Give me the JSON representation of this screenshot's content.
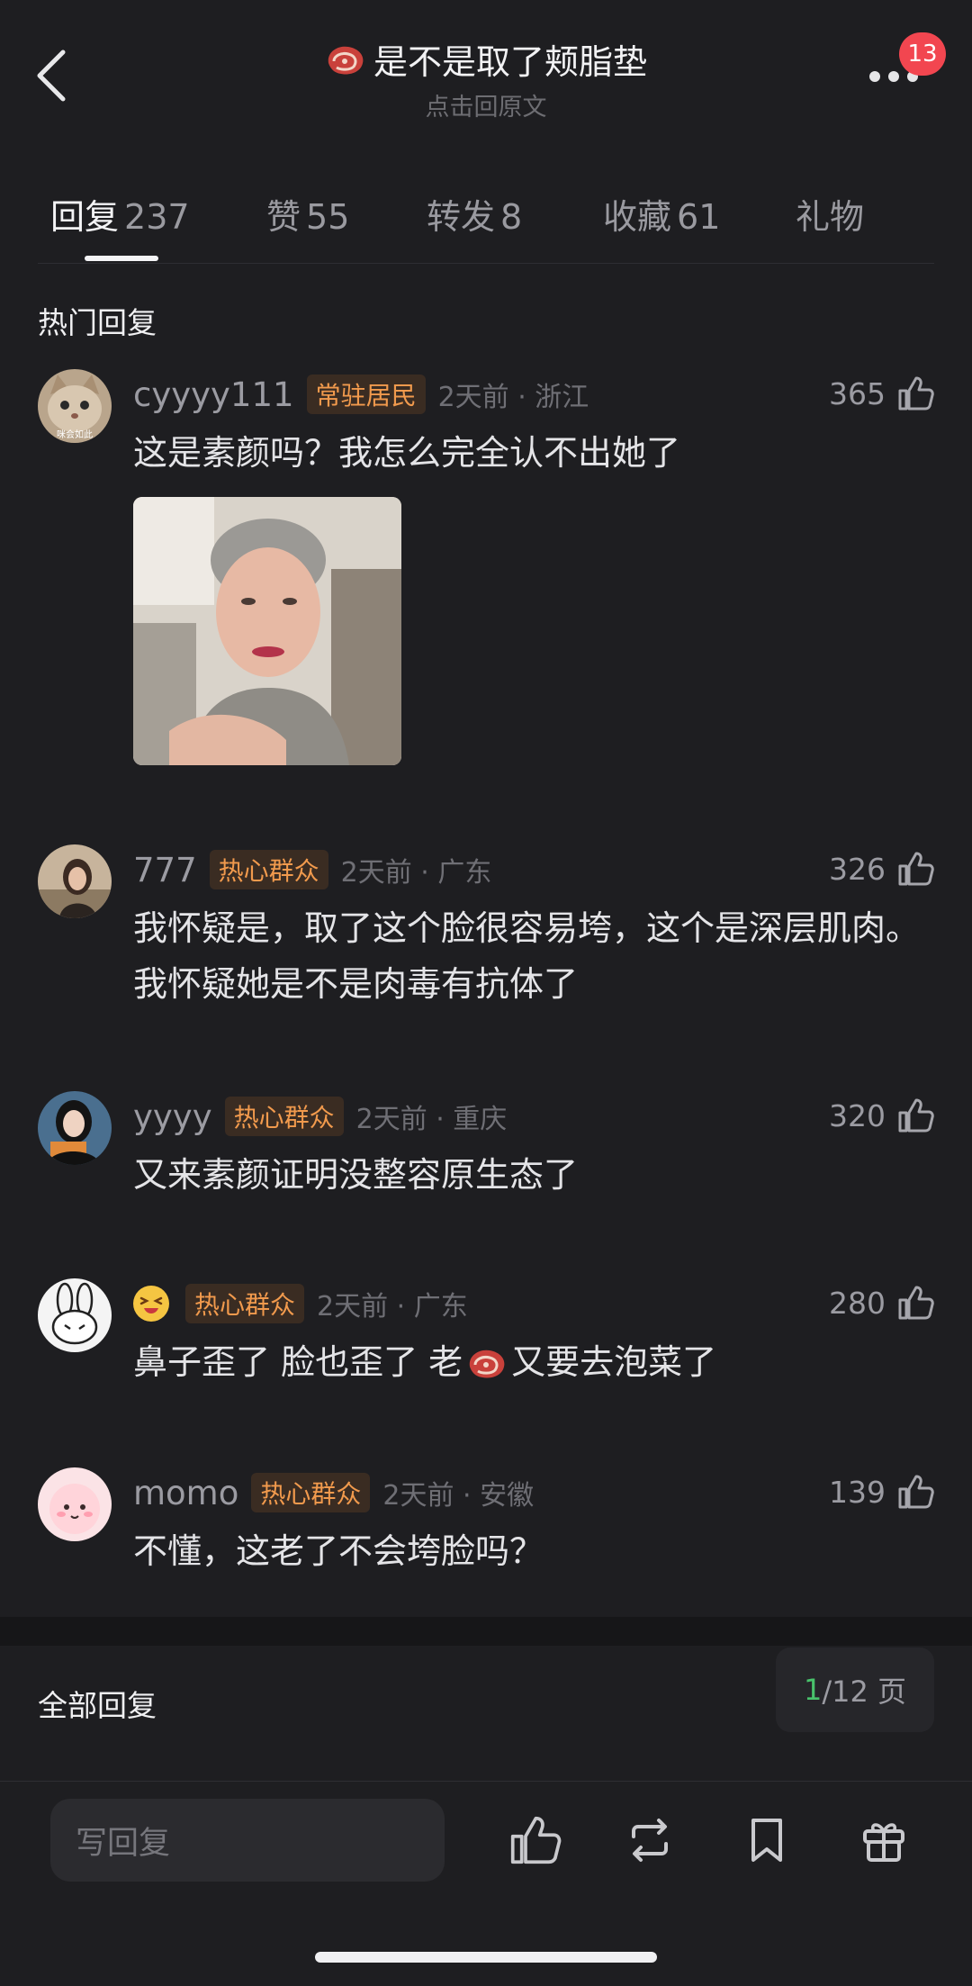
{
  "header": {
    "title": "是不是取了颊脂垫",
    "subtitle": "点击回原文",
    "notification_count": "13",
    "title_icon": "steak-icon"
  },
  "tabs": [
    {
      "label": "回复",
      "count": "237"
    },
    {
      "label": "赞",
      "count": "55"
    },
    {
      "label": "转发",
      "count": "8"
    },
    {
      "label": "收藏",
      "count": "61"
    },
    {
      "label": "礼物",
      "count": ""
    }
  ],
  "hot_section_title": "热门回复",
  "comments": [
    {
      "user": "cyyyy111",
      "tag": "常驻居民",
      "time": "2天前 · 浙江",
      "likes": "365",
      "text": "这是素颜吗？我怎么完全认不出她了",
      "avatar_caption": "咪会如此"
    },
    {
      "user": "777",
      "tag": "热心群众",
      "time": "2天前 · 广东",
      "likes": "326",
      "text": "我怀疑是，取了这个脸很容易垮，这个是深层肌肉。我怀疑她是不是肉毒有抗体了"
    },
    {
      "user": "yyyy",
      "tag": "热心群众",
      "time": "2天前 · 重庆",
      "likes": "320",
      "text": "又来素颜证明没整容原生态了"
    },
    {
      "user": "",
      "tag": "热心群众",
      "time": "2天前 · 广东",
      "likes": "280",
      "text_before": "鼻子歪了 脸也歪了 老",
      "text_after": "又要去泡菜了"
    },
    {
      "user": "momo",
      "tag": "热心群众",
      "time": "2天前 · 安徽",
      "likes": "139",
      "text": "不懂，这老了不会垮脸吗？"
    }
  ],
  "all_replies_title": "全部回复",
  "pager": {
    "current": "1",
    "rest": "/12 页"
  },
  "composer": {
    "placeholder": "写回复"
  },
  "colors": {
    "background": "#1e1e21",
    "tag_text": "#f19a4d",
    "badge": "#f24650",
    "pager_current": "#48c26b"
  }
}
